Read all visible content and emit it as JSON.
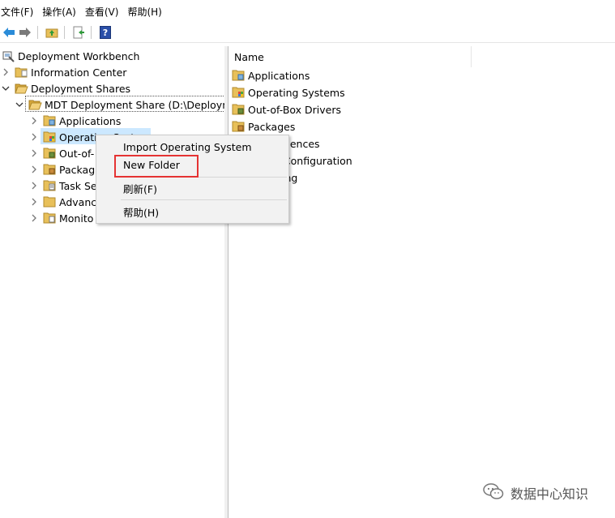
{
  "menubar": {
    "items": [
      "文件(F)",
      "操作(A)",
      "查看(V)",
      "帮助(H)"
    ]
  },
  "toolbar": {
    "icons": [
      "back-arrow-icon",
      "forward-arrow-icon",
      "up-folder-icon",
      "export-list-icon",
      "help-icon"
    ]
  },
  "tree": {
    "root": "Deployment Workbench",
    "info_center": "Information Center",
    "shares": "Deployment Shares",
    "share": "MDT Deployment Share (D:\\Deployme",
    "children": [
      "Applications",
      "Operating Systems",
      "Out-of-",
      "Packag",
      "Task Se",
      "Advanc",
      "Monito"
    ]
  },
  "list": {
    "column_name": "Name",
    "items": [
      "Applications",
      "Operating Systems",
      "Out-of-Box Drivers",
      "Packages",
      "quences",
      "d Configuration",
      "ing"
    ]
  },
  "context_menu": {
    "import": "Import Operating System",
    "new_folder": "New Folder",
    "refresh": "刷新(F)",
    "help": "帮助(H)"
  },
  "watermark": {
    "text": "数据中心知识"
  },
  "colors": {
    "selection": "#cce8ff",
    "highlight_box": "#e53333",
    "folder": "#e8c05a"
  }
}
